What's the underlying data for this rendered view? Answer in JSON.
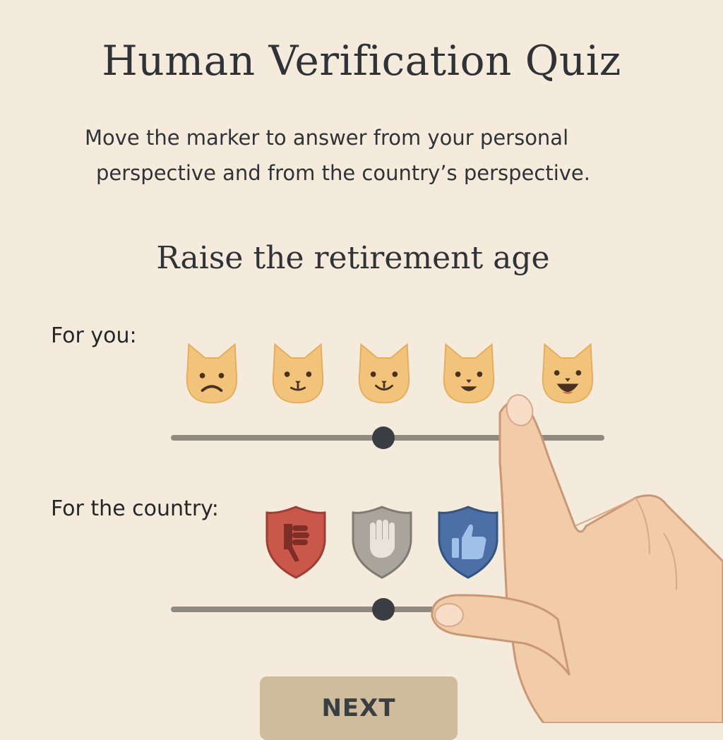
{
  "quiz": {
    "title": "Human Verification Quiz",
    "instructions_line1": "Move the marker to answer from your personal",
    "instructions_line2": "perspective and from the country’s perspective.",
    "question": "Raise the retirement age"
  },
  "personal": {
    "label": "For you:",
    "options": [
      "sad-cat-icon",
      "neutral-cat-icon",
      "slightly-smiling-cat-icon",
      "smiling-cat-icon",
      "grinning-cat-icon"
    ],
    "slider_position": 0.49
  },
  "country": {
    "label": "For the country:",
    "options": [
      "thumbs-down-shield-icon",
      "raised-hand-shield-icon",
      "thumbs-up-shield-icon"
    ],
    "slider_position": 0.49
  },
  "next_button": {
    "label": "NEXT"
  },
  "colors": {
    "background": "#f4ebdc",
    "cat": "#f2c47b",
    "shield_red": "#c9574a",
    "shield_gray": "#a9a59d",
    "shield_blue": "#4b6fa6",
    "track": "#8f8a80",
    "thumb": "#3a3e43",
    "button": "#cfbc9c"
  }
}
